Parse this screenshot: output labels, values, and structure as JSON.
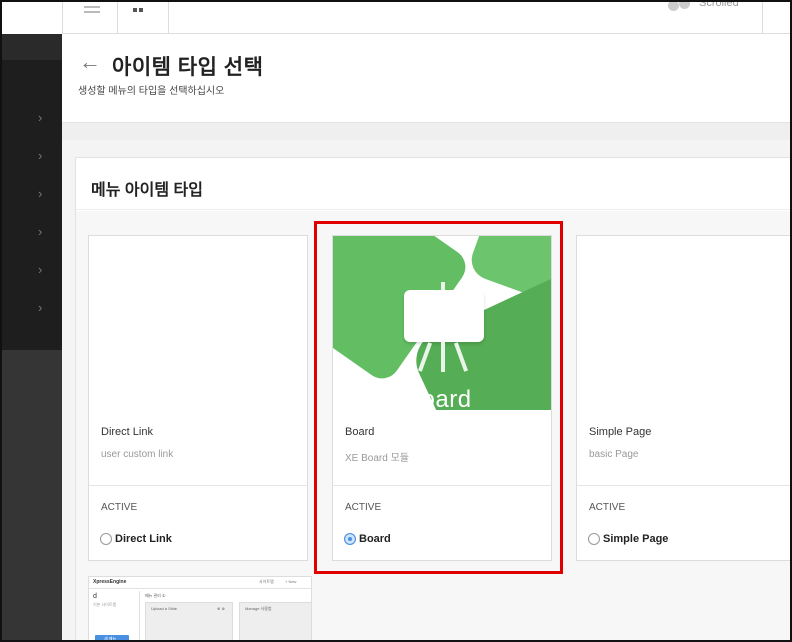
{
  "header": {
    "user_name": "Scrolled"
  },
  "sidebar": {
    "items": [
      {
        "icon": "chevron-right-icon",
        "glyph": "›"
      },
      {
        "icon": "chevron-right-icon",
        "glyph": "›"
      },
      {
        "icon": "chevron-right-icon",
        "glyph": "›"
      },
      {
        "icon": "chevron-right-icon",
        "glyph": "›"
      },
      {
        "icon": "chevron-right-icon",
        "glyph": "›"
      },
      {
        "icon": "chevron-right-icon",
        "glyph": "›"
      }
    ]
  },
  "page": {
    "back_glyph": "←",
    "title": "아이템 타입 선택",
    "subtitle": "생성할 메뉴의 타입을 선택하십시오"
  },
  "panel": {
    "title": "메뉴 아이템 타입"
  },
  "cards": [
    {
      "title": "Direct Link",
      "description": "user custom link",
      "status": "ACTIVE",
      "radio_label": "Direct Link",
      "selected": false
    },
    {
      "title": "Board",
      "description": "XE Board 모듈",
      "status": "ACTIVE",
      "radio_label": "Board",
      "selected": true,
      "thumbnail_text": "Board",
      "thumbnail_color": "#5cb85c"
    },
    {
      "title": "Simple Page",
      "description": "basic Page",
      "status": "ACTIVE",
      "radio_label": "Simple Page",
      "selected": false
    }
  ],
  "highlight_color": "#e00000",
  "mini_preview": {
    "title": "XpressEngine",
    "right1": "사이트맵",
    "right2": "+ New",
    "left_big": "d",
    "left_small": "기본 사이트맵",
    "header": "메뉴 관리 ①",
    "box1": "Upload a Slide",
    "box1_icons": "⊕ ⊗",
    "box2": "Manage 사용법",
    "button": "새 메뉴"
  }
}
